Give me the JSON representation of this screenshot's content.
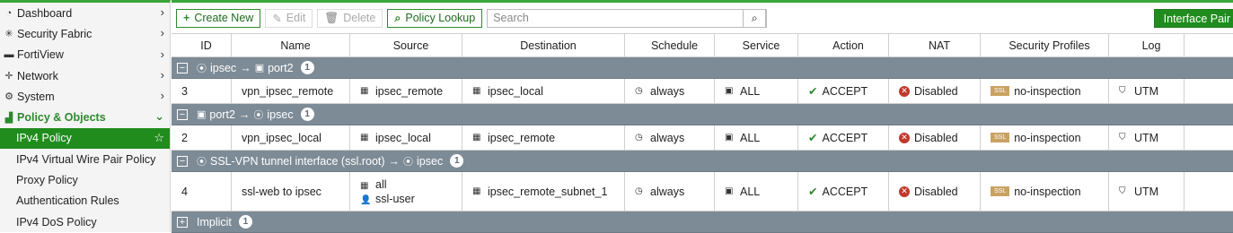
{
  "sidebar": {
    "items": [
      {
        "label": "Dashboard",
        "icon": "dashboard-icon"
      },
      {
        "label": "Security Fabric",
        "icon": "fabric-icon"
      },
      {
        "label": "FortiView",
        "icon": "chart-icon"
      },
      {
        "label": "Network",
        "icon": "network-icon"
      },
      {
        "label": "System",
        "icon": "gear-icon"
      },
      {
        "label": "Policy & Objects",
        "icon": "policy-icon"
      }
    ],
    "sub_items": [
      {
        "label": "IPv4 Policy"
      },
      {
        "label": "IPv4 Virtual Wire Pair Policy"
      },
      {
        "label": "Proxy Policy"
      },
      {
        "label": "Authentication Rules"
      },
      {
        "label": "IPv4 DoS Policy"
      }
    ]
  },
  "toolbar": {
    "create_new": "Create New",
    "edit": "Edit",
    "delete": "Delete",
    "policy_lookup": "Policy Lookup",
    "search_placeholder": "Search",
    "interface_pair": "Interface Pair"
  },
  "table": {
    "columns": [
      "ID",
      "Name",
      "Source",
      "Destination",
      "Schedule",
      "Service",
      "Action",
      "NAT",
      "Security Profiles",
      "Log"
    ],
    "groups": [
      {
        "from": "ipsec",
        "arrow": "→",
        "to": "port2",
        "count": "1",
        "rows": [
          {
            "id": "3",
            "name": "vpn_ipsec_remote",
            "source": [
              "ipsec_remote"
            ],
            "destination": "ipsec_local",
            "schedule": "always",
            "service": "ALL",
            "action": "ACCEPT",
            "nat": "Disabled",
            "profile_tag": "SSL",
            "profile": "no-inspection",
            "log": "UTM"
          }
        ]
      },
      {
        "from": "port2",
        "arrow": "→",
        "to": "ipsec",
        "count": "1",
        "rows": [
          {
            "id": "2",
            "name": "vpn_ipsec_local",
            "source": [
              "ipsec_local"
            ],
            "destination": "ipsec_remote",
            "schedule": "always",
            "service": "ALL",
            "action": "ACCEPT",
            "nat": "Disabled",
            "profile_tag": "SSL",
            "profile": "no-inspection",
            "log": "UTM"
          }
        ]
      },
      {
        "from": "SSL-VPN tunnel interface (ssl.root)",
        "arrow": "→",
        "to": "ipsec",
        "count": "1",
        "rows": [
          {
            "id": "4",
            "name": "ssl-web to ipsec",
            "source": [
              "all",
              "ssl-user"
            ],
            "destination": "ipsec_remote_subnet_1",
            "schedule": "always",
            "service": "ALL",
            "action": "ACCEPT",
            "nat": "Disabled",
            "profile_tag": "SSL",
            "profile": "no-inspection",
            "log": "UTM"
          }
        ]
      }
    ],
    "implicit": {
      "label": "Implicit",
      "count": "1"
    }
  },
  "colors": {
    "accent": "#218c1e",
    "group_bar": "#7d8b96",
    "ssl_tag": "#c9a262",
    "nat_disabled": "#c0392b"
  }
}
